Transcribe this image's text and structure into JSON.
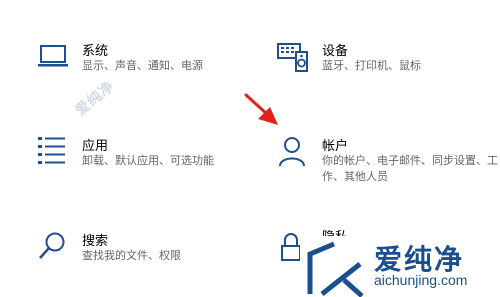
{
  "settings_tiles": [
    {
      "title": "系统",
      "desc": "显示、声音、通知、电源",
      "icon": "laptop-icon"
    },
    {
      "title": "设备",
      "desc": "蓝牙、打印机、鼠标",
      "icon": "keyboard-speaker-icon"
    },
    {
      "title": "应用",
      "desc": "卸载、默认应用、可选功能",
      "icon": "apps-list-icon"
    },
    {
      "title": "帐户",
      "desc": "你的帐户、电子邮件、同步设置、工作、其他人员",
      "icon": "person-icon"
    },
    {
      "title": "搜索",
      "desc": "查找我的文件、权限",
      "icon": "search-icon"
    },
    {
      "title": "隐私",
      "desc": "",
      "icon": "lock-icon"
    }
  ],
  "annotation": {
    "color": "#e0221a",
    "icon": "red-arrow-icon"
  },
  "watermark": {
    "diagonal_text": "爱纯净",
    "brand": "爱纯净",
    "site": "aichunjing.com",
    "color": "#1b4e8c",
    "icon": "logo-icon"
  },
  "colors": {
    "icon_blue": "#1f4f8f",
    "desc_gray": "#666666"
  }
}
